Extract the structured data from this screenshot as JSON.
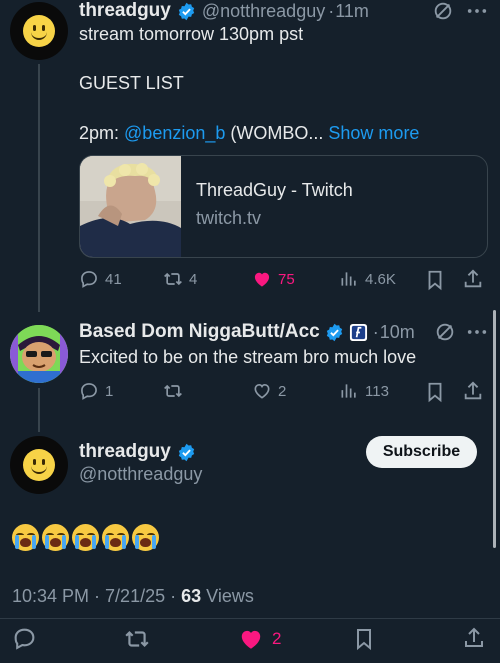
{
  "colors": {
    "background": "#15202b",
    "accent": "#1d9bf0",
    "like": "#f91880",
    "verified": "#1d9bf0",
    "muted": "#8b98a5"
  },
  "tweet1": {
    "author_name": "threadguy",
    "handle": "@notthreadguy",
    "sep": "·",
    "time": "11m",
    "line1": "stream tomorrow 130pm pst",
    "line2": "GUEST LIST",
    "line3_prefix": "2pm: ",
    "line3_mention": "@benzion_b",
    "line3_rest": " (WOMBO...",
    "show_more": "Show more",
    "card": {
      "title": "ThreadGuy - Twitch",
      "domain": "twitch.tv"
    },
    "actions": {
      "replies": "41",
      "reposts": "4",
      "likes": "75",
      "views": "4.6K"
    },
    "liked": true
  },
  "tweet2": {
    "author_name": "Based Dom NiggaButt/Acc",
    "sep": "·",
    "time": "10m",
    "text": "Excited to be on the stream bro much love",
    "actions": {
      "replies": "1",
      "reposts": "",
      "likes": "2",
      "views": "113"
    }
  },
  "tweet3": {
    "author_name": "threadguy",
    "handle": "@notthreadguy",
    "subscribe_label": "Subscribe",
    "emojis": [
      "loudly-crying-face",
      "loudly-crying-face",
      "loudly-crying-face",
      "loudly-crying-face",
      "loudly-crying-face"
    ],
    "time": "10:34 PM",
    "dot1": " · ",
    "date": "7/21/25",
    "dot2": " · ",
    "views_count": "63",
    "views_label": " Views",
    "likes": "2"
  }
}
